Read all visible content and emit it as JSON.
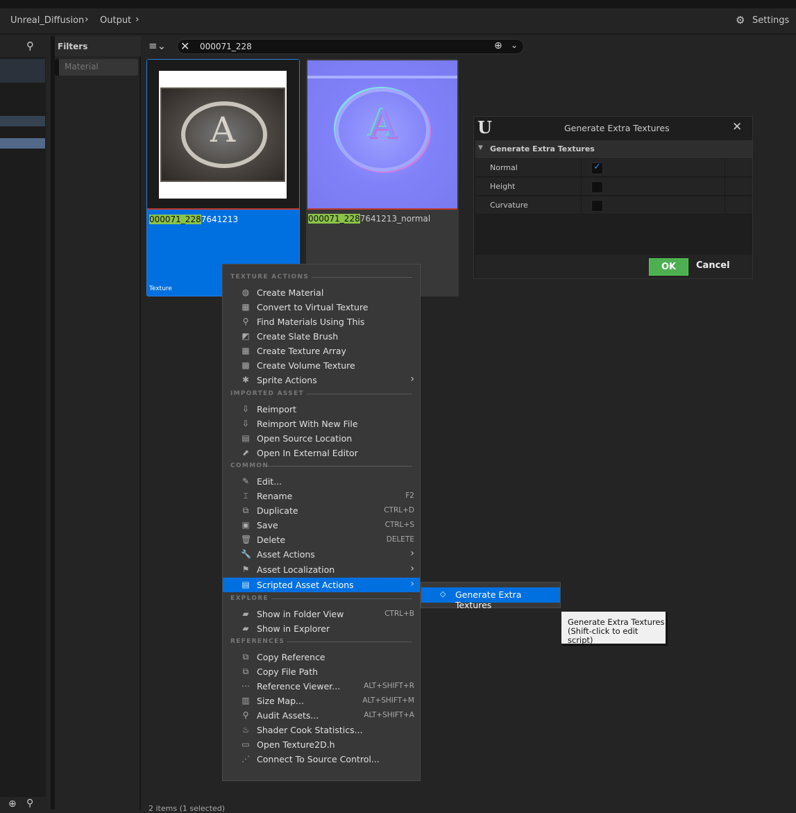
{
  "breadcrumb": [
    "Unreal_Diffusion",
    "Output"
  ],
  "settings_label": "Settings",
  "filters": {
    "title": "Filters",
    "chip": "Material"
  },
  "search": {
    "value": "000071_228"
  },
  "assets": [
    {
      "highlight": "000071_228",
      "rest": "7641213",
      "type": "Texture",
      "selected": true
    },
    {
      "highlight": "000071_228",
      "rest": "7641213_normal",
      "selected": false
    }
  ],
  "status": "2 items (1 selected)",
  "menu": [
    {
      "section": "TEXTURE ACTIONS"
    },
    {
      "label": "Create Material",
      "icon": "material-icon"
    },
    {
      "label": "Convert to Virtual Texture",
      "icon": "checker-icon"
    },
    {
      "label": "Find Materials Using This",
      "icon": "search-icon"
    },
    {
      "label": "Create Slate Brush",
      "icon": "brush-icon"
    },
    {
      "label": "Create Texture Array",
      "icon": "checker-icon"
    },
    {
      "label": "Create Volume Texture",
      "icon": "volume-icon"
    },
    {
      "label": "Sprite Actions",
      "icon": "sprite-icon",
      "submenu": true
    },
    {
      "section": "IMPORTED ASSET"
    },
    {
      "label": "Reimport",
      "icon": "reimport-icon"
    },
    {
      "label": "Reimport With New File",
      "icon": "reimport-icon"
    },
    {
      "label": "Open Source Location",
      "icon": "folder-icon"
    },
    {
      "label": "Open In External Editor",
      "icon": "external-icon"
    },
    {
      "section": "COMMON"
    },
    {
      "label": "Edit...",
      "icon": "pencil-icon"
    },
    {
      "label": "Rename",
      "icon": "rename-icon",
      "shortcut": "F2"
    },
    {
      "label": "Duplicate",
      "icon": "duplicate-icon",
      "shortcut": "CTRL+D"
    },
    {
      "label": "Save",
      "icon": "save-icon",
      "shortcut": "CTRL+S"
    },
    {
      "label": "Delete",
      "icon": "trash-icon",
      "shortcut": "DELETE"
    },
    {
      "label": "Asset Actions",
      "icon": "wrench-icon",
      "submenu": true
    },
    {
      "label": "Asset Localization",
      "icon": "flag-icon",
      "submenu": true
    },
    {
      "label": "Scripted Asset Actions",
      "icon": "script-icon",
      "submenu": true,
      "highlighted": true
    },
    {
      "section": "EXPLORE"
    },
    {
      "label": "Show in Folder View",
      "icon": "folder-search-icon",
      "shortcut": "CTRL+B"
    },
    {
      "label": "Show in Explorer",
      "icon": "folder-search-icon"
    },
    {
      "section": "REFERENCES"
    },
    {
      "label": "Copy Reference",
      "icon": "copy-icon"
    },
    {
      "label": "Copy File Path",
      "icon": "copy-icon"
    },
    {
      "label": "Reference Viewer...",
      "icon": "graph-icon",
      "shortcut": "ALT+SHIFT+R"
    },
    {
      "label": "Size Map...",
      "icon": "sizemap-icon",
      "shortcut": "ALT+SHIFT+M"
    },
    {
      "label": "Audit Assets...",
      "icon": "audit-icon",
      "shortcut": "ALT+SHIFT+A"
    },
    {
      "label": "Shader Cook Statistics...",
      "icon": "stats-icon"
    },
    {
      "label": "Open Texture2D.h",
      "icon": "code-icon"
    },
    {
      "label": "Connect To Source Control...",
      "icon": "source-control-icon"
    }
  ],
  "submenu": {
    "label": "Generate Extra Textures"
  },
  "tooltip": {
    "line1": "Generate Extra Textures",
    "line2": "(Shift-click to edit script)"
  },
  "dialog": {
    "title": "Generate Extra Textures",
    "section": "Generate Extra Textures",
    "options": [
      {
        "label": "Normal",
        "checked": true
      },
      {
        "label": "Height",
        "checked": false
      },
      {
        "label": "Curvature",
        "checked": false
      }
    ],
    "ok": "OK",
    "cancel": "Cancel"
  },
  "colors": {
    "accent": "#0070e0",
    "highlight": "#8bc34a",
    "ok": "#4caf50"
  }
}
